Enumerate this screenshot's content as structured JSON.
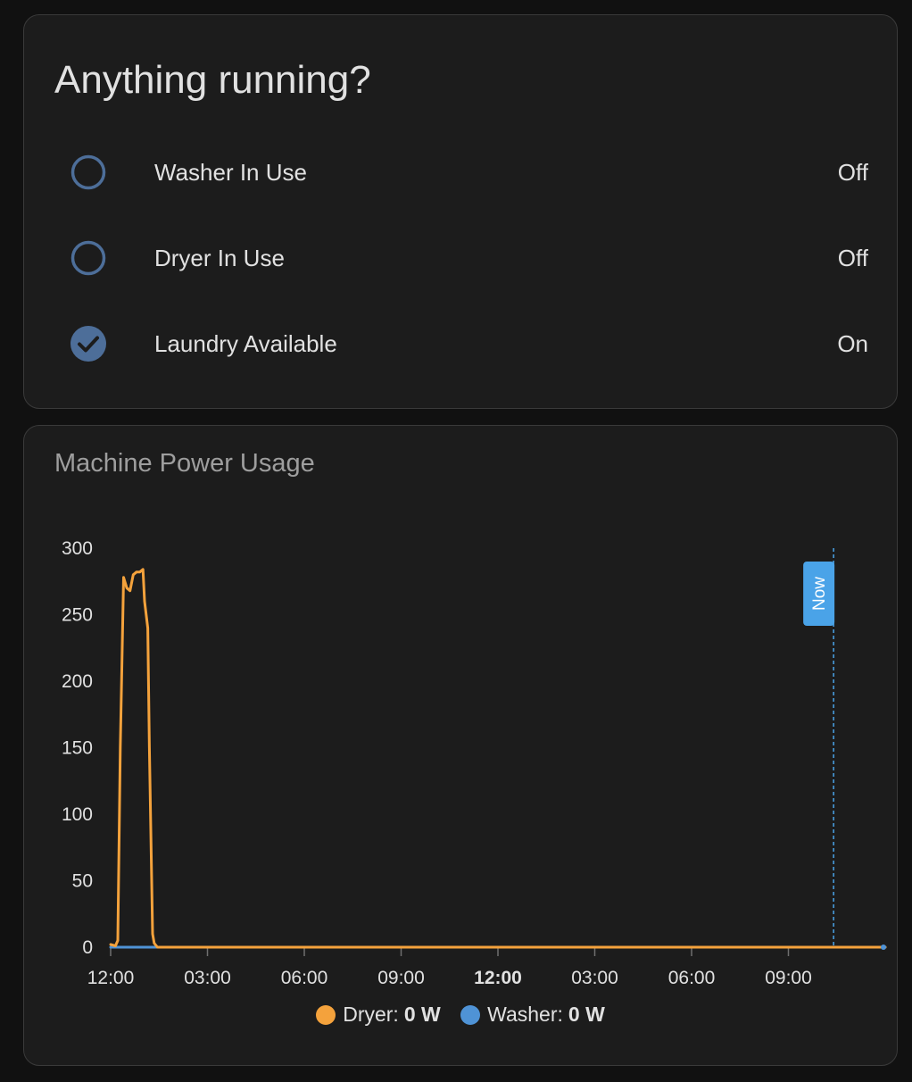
{
  "status_card": {
    "title": "Anything running?",
    "entities": [
      {
        "name": "Washer In Use",
        "state": "Off",
        "icon": "radiobox-blank-icon"
      },
      {
        "name": "Dryer In Use",
        "state": "Off",
        "icon": "radiobox-blank-icon"
      },
      {
        "name": "Laundry Available",
        "state": "On",
        "icon": "check-circle-icon"
      }
    ]
  },
  "chart_card": {
    "title": "Machine Power Usage",
    "now_label": "Now",
    "legend": [
      {
        "name": "Dryer:",
        "value": "0 W",
        "color": "#f4a23c"
      },
      {
        "name": "Washer:",
        "value": "0 W",
        "color": "#4f93d6"
      }
    ]
  },
  "chart_data": {
    "type": "line",
    "title": "Machine Power Usage",
    "ylim": [
      0,
      300
    ],
    "yticks": [
      0,
      50,
      100,
      150,
      200,
      250,
      300
    ],
    "xlim": [
      0,
      24
    ],
    "xticks": [
      0,
      3,
      6,
      9,
      12,
      15,
      18,
      21
    ],
    "xtick_labels": [
      "12:00",
      "03:00",
      "06:00",
      "09:00",
      "12:00",
      "03:00",
      "06:00",
      "09:00"
    ],
    "xtick_bold": [
      false,
      false,
      false,
      false,
      true,
      false,
      false,
      false
    ],
    "now_x": 22.4,
    "series": [
      {
        "name": "Dryer",
        "color": "#f4a23c",
        "x": [
          0,
          0.15,
          0.22,
          0.3,
          0.4,
          0.5,
          0.6,
          0.7,
          0.8,
          0.9,
          1.0,
          1.05,
          1.15,
          1.2,
          1.3,
          1.35,
          1.45,
          1.6,
          1.8,
          24
        ],
        "y": [
          2,
          1,
          5,
          150,
          278,
          270,
          268,
          280,
          282,
          282,
          284,
          260,
          240,
          150,
          10,
          3,
          0,
          0,
          0,
          0
        ]
      },
      {
        "name": "Washer",
        "color": "#4f93d6",
        "x": [
          0,
          24
        ],
        "y": [
          0,
          0
        ]
      }
    ]
  }
}
